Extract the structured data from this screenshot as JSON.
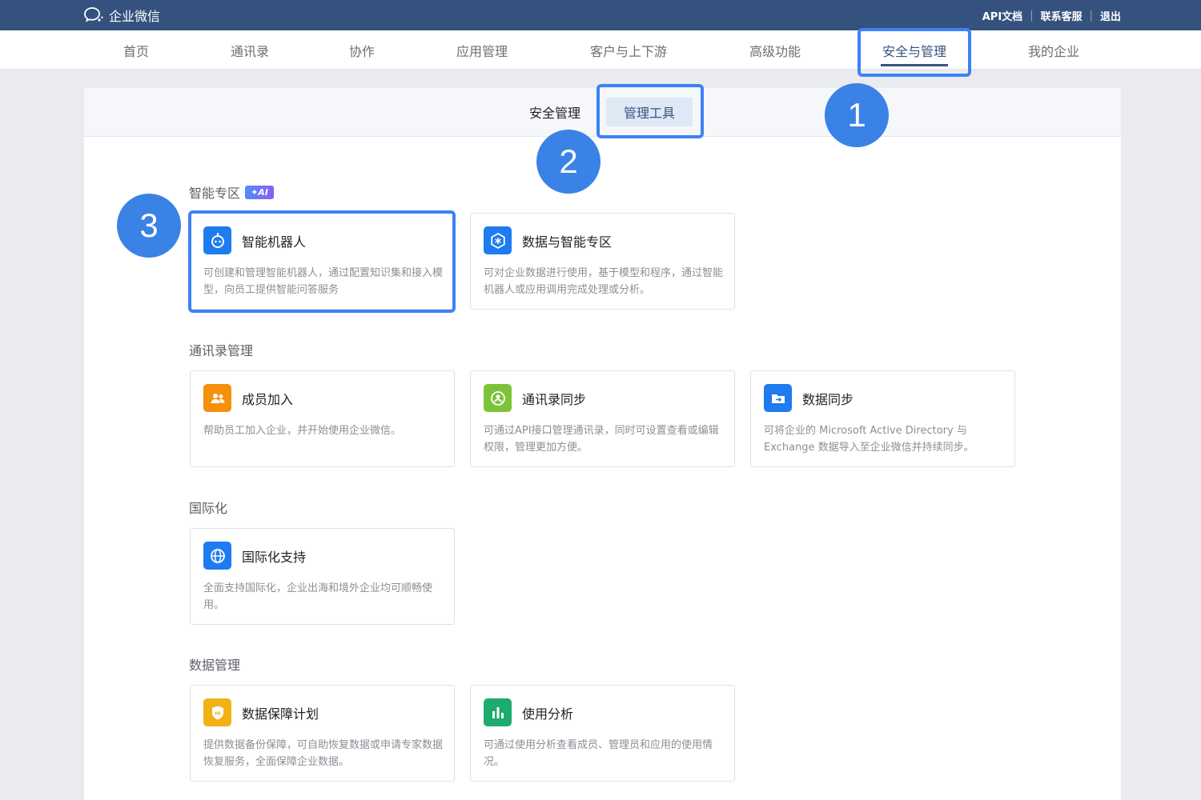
{
  "header": {
    "logo_text": "企业微信",
    "links": [
      "API文档",
      "联系客服",
      "退出"
    ]
  },
  "nav": {
    "items": [
      "首页",
      "通讯录",
      "协作",
      "应用管理",
      "客户与上下游",
      "高级功能",
      "安全与管理",
      "我的企业"
    ],
    "active": "安全与管理"
  },
  "subtabs": {
    "items": [
      "安全管理",
      "管理工具"
    ],
    "active": "管理工具"
  },
  "sections": [
    {
      "title": "智能专区",
      "badge": "✦AI",
      "cards": [
        {
          "title": "智能机器人",
          "desc": "可创建和管理智能机器人，通过配置知识集和接入模型，向员工提供智能问答服务",
          "icon": "robot-icon",
          "color": "#1e7bf0"
        },
        {
          "title": "数据与智能专区",
          "desc": "可对企业数据进行使用，基于模型和程序，通过智能机器人或应用调用完成处理或分析。",
          "icon": "data-zone-icon",
          "color": "#1e7bf0"
        }
      ]
    },
    {
      "title": "通讯录管理",
      "cards": [
        {
          "title": "成员加入",
          "desc": "帮助员工加入企业，并开始使用企业微信。",
          "icon": "members-icon",
          "color": "#f5900c"
        },
        {
          "title": "通讯录同步",
          "desc": "可通过API接口管理通讯录，同时可设置查看或编辑权限，管理更加方便。",
          "icon": "contacts-sync-icon",
          "color": "#7cc33a"
        },
        {
          "title": "数据同步",
          "desc": "可将企业的 Microsoft Active Directory 与 Exchange 数据导入至企业微信并持续同步。",
          "icon": "folder-sync-icon",
          "color": "#1e7bf0"
        }
      ]
    },
    {
      "title": "国际化",
      "cards": [
        {
          "title": "国际化支持",
          "desc": "全面支持国际化，企业出海和境外企业均可顺畅使用。",
          "icon": "globe-icon",
          "color": "#1e7bf0"
        }
      ]
    },
    {
      "title": "数据管理",
      "cards": [
        {
          "title": "数据保障计划",
          "desc": "提供数据备份保障，可自助恢复数据或申请专家数据恢复服务，全面保障企业数据。",
          "icon": "shield-icon",
          "color": "#f2b216"
        },
        {
          "title": "使用分析",
          "desc": "可通过使用分析查看成员、管理员和应用的使用情况。",
          "icon": "bar-chart-icon",
          "color": "#1eab6e"
        }
      ]
    }
  ],
  "steps": [
    "1",
    "2",
    "3"
  ],
  "colors": {
    "topbar": "#35527e",
    "accent": "#3b82e6"
  }
}
